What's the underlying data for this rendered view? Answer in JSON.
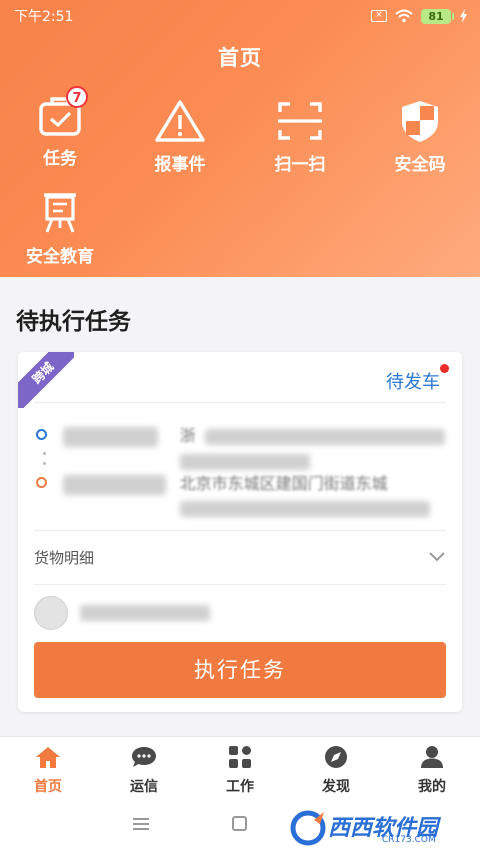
{
  "status_bar": {
    "time": "下午2:51",
    "battery": "81"
  },
  "header": {
    "title": "首页",
    "quick_actions": [
      {
        "label": "任务",
        "icon": "briefcase-icon",
        "badge": "7"
      },
      {
        "label": "报事件",
        "icon": "warning-triangle-icon"
      },
      {
        "label": "扫一扫",
        "icon": "scan-icon"
      },
      {
        "label": "安全码",
        "icon": "shield-icon"
      },
      {
        "label": "安全教育",
        "icon": "easel-icon"
      }
    ]
  },
  "pending": {
    "title": "待执行任务",
    "card": {
      "corner_tag": "跨城",
      "status": "待发车",
      "origin_city_prefix": "浙",
      "dest_detail": "北京市东城区建国门街道东城",
      "goods_label": "货物明细",
      "action_button": "执行任务"
    }
  },
  "tabbar": {
    "items": [
      {
        "label": "首页",
        "icon": "home-icon",
        "active": true
      },
      {
        "label": "运信",
        "icon": "chat-icon"
      },
      {
        "label": "工作",
        "icon": "grid-icon"
      },
      {
        "label": "发现",
        "icon": "compass-icon"
      },
      {
        "label": "我的",
        "icon": "user-icon"
      }
    ]
  },
  "watermark": {
    "text": "西西软件园",
    "sub": "CR173.COM"
  },
  "colors": {
    "accent": "#f07a40",
    "header_gradient_start": "#f7824a",
    "header_gradient_end": "#ffab7e",
    "status_blue": "#2b78d6",
    "tag_purple": "#7c66c8",
    "badge_red": "#f0333a"
  }
}
